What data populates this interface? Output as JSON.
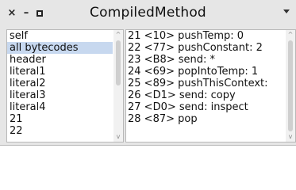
{
  "window": {
    "title": "CompiledMethod",
    "close_glyph": "×",
    "minimize_glyph": "–",
    "menu_icon": "triangle-down-icon"
  },
  "left_list": {
    "items": [
      {
        "label": "self"
      },
      {
        "label": "all bytecodes",
        "selected": true
      },
      {
        "label": "header"
      },
      {
        "label": "literal1"
      },
      {
        "label": "literal2"
      },
      {
        "label": "literal3"
      },
      {
        "label": "literal4"
      },
      {
        "label": "21"
      },
      {
        "label": "22"
      }
    ]
  },
  "bytecodes": {
    "lines": [
      "21 <10> pushTemp: 0",
      "22 <77> pushConstant: 2",
      "23 <B8> send: *",
      "24 <69> popIntoTemp: 1",
      "25 <89> pushThisContext:",
      "26 <D1> send: copy",
      "27 <D0> send: inspect",
      "28 <87> pop"
    ]
  },
  "scroll_glyphs": {
    "up": "^",
    "down": "v"
  },
  "colors": {
    "selection": "#c7d8ef",
    "window_bg": "#e6e6e6"
  }
}
